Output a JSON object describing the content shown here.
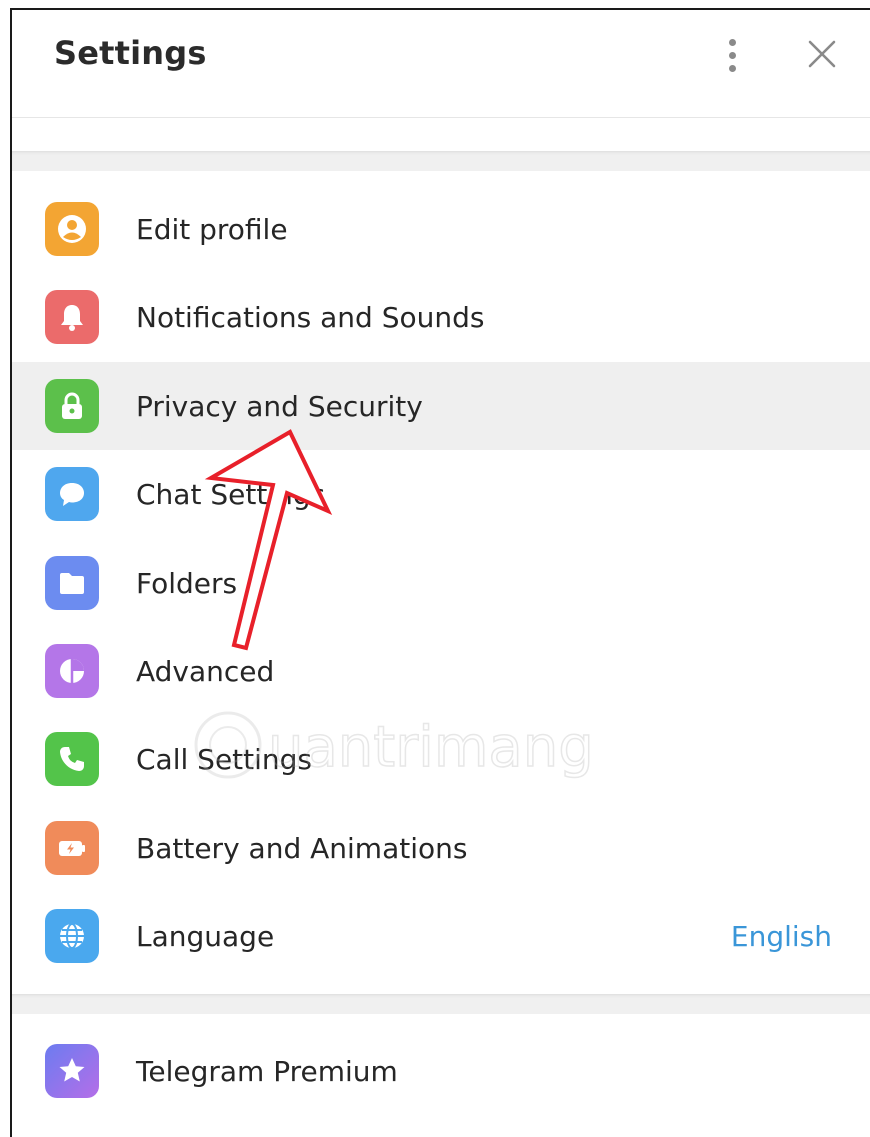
{
  "header": {
    "title": "Settings",
    "more_icon": "more-vertical-icon",
    "close_icon": "close-icon"
  },
  "menu": {
    "items": [
      {
        "label": "Edit profile",
        "icon": "user-icon",
        "color": "#F3A533"
      },
      {
        "label": "Notifications and Sounds",
        "icon": "bell-icon",
        "color": "#EB6B6B"
      },
      {
        "label": "Privacy and Security",
        "icon": "lock-icon",
        "color": "#5CC04B",
        "active": true
      },
      {
        "label": "Chat Settings",
        "icon": "chat-bubble-icon",
        "color": "#4FA7EE"
      },
      {
        "label": "Folders",
        "icon": "folder-icon",
        "color": "#6C8CF0"
      },
      {
        "label": "Advanced",
        "icon": "pie-chart-icon",
        "color": "#B476E8"
      },
      {
        "label": "Call Settings",
        "icon": "phone-icon",
        "color": "#53C44A"
      },
      {
        "label": "Battery and Animations",
        "icon": "battery-icon",
        "color": "#F08B5A"
      },
      {
        "label": "Language",
        "icon": "globe-icon",
        "color": "#4AA8EE",
        "value": "English"
      }
    ],
    "premium": {
      "label": "Telegram Premium",
      "icon": "star-icon",
      "color": "#8E6EF0"
    }
  },
  "accent_color": "#3A96D8",
  "annotation_color": "#E8202A"
}
